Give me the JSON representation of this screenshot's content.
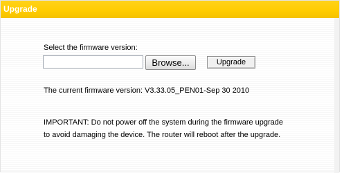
{
  "panel": {
    "title": "Upgrade"
  },
  "form": {
    "select_label": "Select the firmware version:",
    "file_value": "",
    "browse_label": "Browse...",
    "upgrade_label": "Upgrade"
  },
  "status": {
    "current_version": "The current firmware version: V3.33.05_PEN01-Sep 30 2010"
  },
  "notice": {
    "line1": "IMPORTANT: Do not power off the system during the firmware upgrade",
    "line2": "to avoid damaging the device. The router will reboot after the upgrade."
  },
  "colors": {
    "titlebar": "#ffcc00",
    "title_text": "#ffffff"
  }
}
